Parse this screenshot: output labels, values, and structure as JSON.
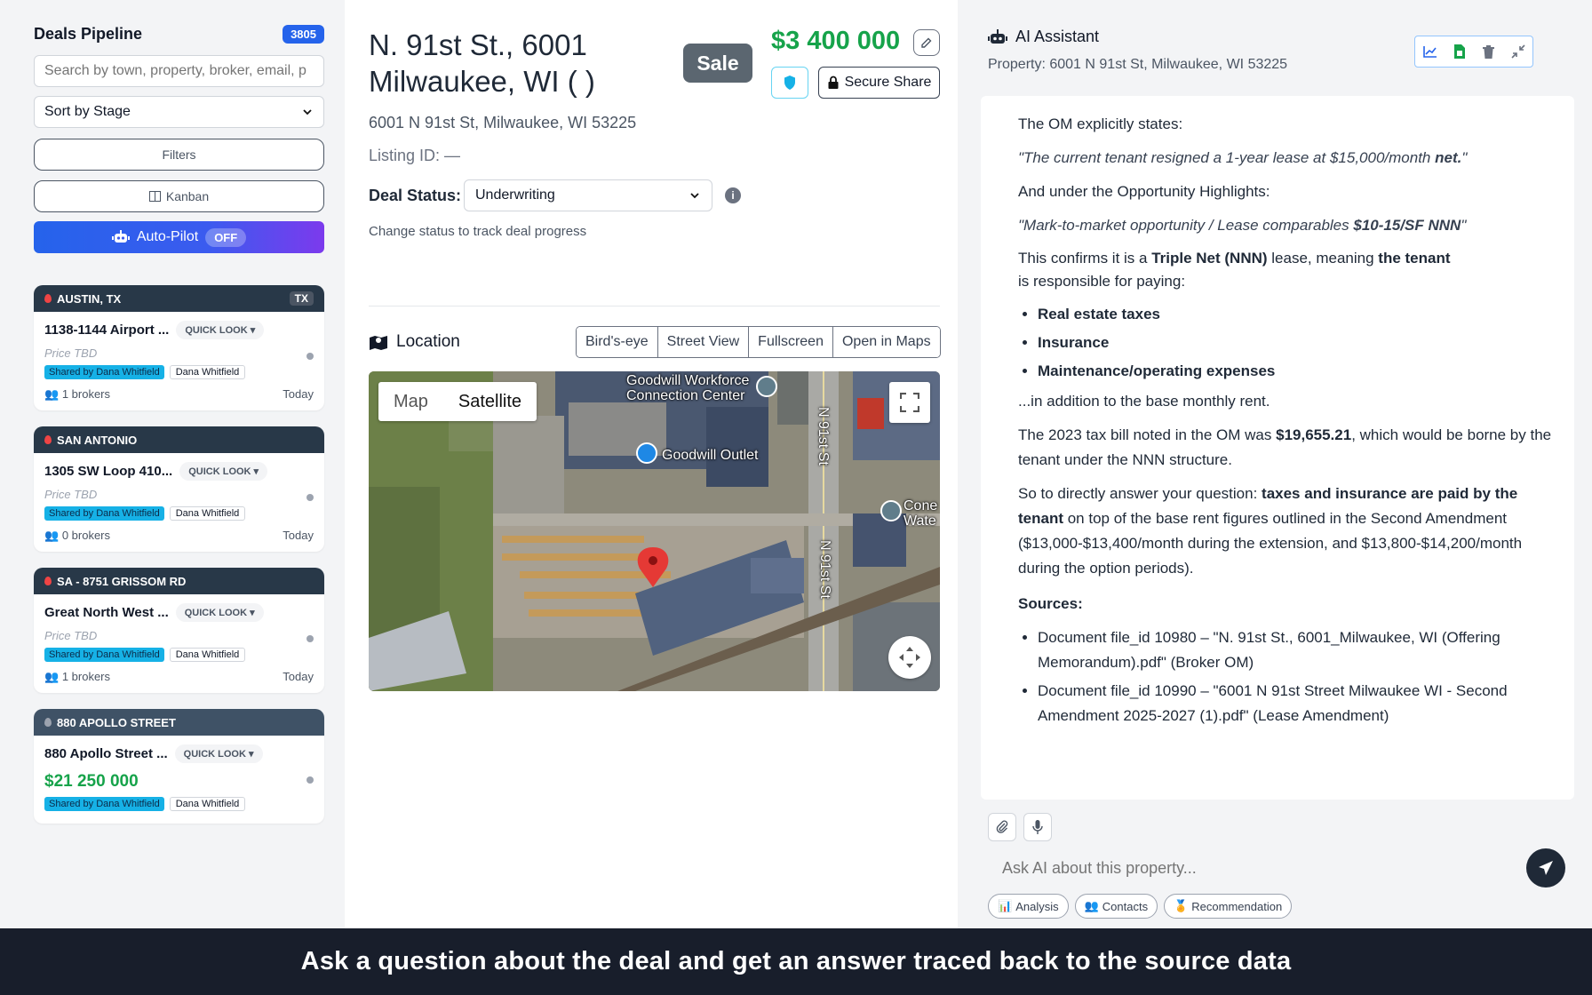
{
  "sidebar": {
    "title": "Deals Pipeline",
    "count": "3805",
    "search_placeholder": "Search by town, property, broker, email, p",
    "sort_label": "Sort by Stage",
    "filters_label": "Filters",
    "kanban_label": "Kanban",
    "autopilot_label": "Auto-Pilot",
    "autopilot_state": "OFF",
    "cards": [
      {
        "header": "AUSTIN, TX",
        "state_badge": "TX",
        "address": "1138-1144 Airport ...",
        "quick_look": "QUICK LOOK",
        "price": "Price TBD",
        "shared": "Shared by Dana Whitfield",
        "broker": "Dana Whitfield",
        "brokers": "1 brokers",
        "date": "Today"
      },
      {
        "header": "SAN ANTONIO",
        "address": "1305 SW Loop 410...",
        "quick_look": "QUICK LOOK",
        "price": "Price TBD",
        "shared": "Shared by Dana Whitfield",
        "broker": "Dana Whitfield",
        "brokers": "0 brokers",
        "date": "Today"
      },
      {
        "header": "SA - 8751 GRISSOM RD",
        "address": "Great North West ...",
        "quick_look": "QUICK LOOK",
        "price": "Price TBD",
        "shared": "Shared by Dana Whitfield",
        "broker": "Dana Whitfield",
        "brokers": "1 brokers",
        "date": "Today"
      },
      {
        "header": "880 APOLLO STREET",
        "address": "880 Apollo Street ...",
        "quick_look": "QUICK LOOK",
        "price": "$21 250 000",
        "shared": "Shared by Dana Whitfield",
        "broker": "Dana Whitfield"
      }
    ]
  },
  "main": {
    "title": "N. 91st St., 6001 Milwaukee, WI ( )",
    "sale_badge": "Sale",
    "price": "$3 400 000",
    "secure_share": "Secure Share",
    "address": "6001 N 91st St, Milwaukee, WI 53225",
    "listing_id": "Listing ID: —",
    "deal_status_label": "Deal Status:",
    "deal_status_value": "Underwriting",
    "deal_status_help": "Change status to track deal progress",
    "location_label": "Location",
    "map_tabs": [
      "Bird's-eye",
      "Street View",
      "Fullscreen",
      "Open in Maps"
    ],
    "map_type_map": "Map",
    "map_type_satellite": "Satellite",
    "map_labels": {
      "goodwill_center_1": "Goodwill Workforce",
      "goodwill_center_2": "Connection Center",
      "goodwill_outlet": "Goodwill Outlet",
      "street_n91": "N 91st St",
      "street_n91_b": "N 91st St",
      "cone_1": "Cone",
      "cone_2": "Wate"
    }
  },
  "ai": {
    "title": "AI Assistant",
    "property": "Property: 6001 N 91st St, Milwaukee, WI 53225",
    "msg": {
      "p1": "The OM explicitly states:",
      "q1a": "\"The current tenant resigned a 1-year lease at $15,000/month ",
      "q1b": "net.",
      "q1c": "\"",
      "p2": "And under the Opportunity Highlights:",
      "q2a": "\"Mark-to-market opportunity / Lease comparables ",
      "q2b": "$10-15/SF NNN",
      "q2c": "\"",
      "p3a": "This confirms it is a ",
      "p3b": "Triple Net (NNN)",
      "p3c": " lease, meaning ",
      "p3d": "the tenant",
      "p3e": "is responsible for paying:",
      "bullets": [
        "Real estate taxes",
        "Insurance",
        "Maintenance/operating expenses"
      ],
      "p4": "...in addition to the base monthly rent.",
      "p5a": "The 2023 tax bill noted in the OM was ",
      "p5b": "$19,655.21",
      "p5c": ", which would be borne by the tenant under the NNN structure.",
      "p6a": "So to directly answer your question: ",
      "p6b": "taxes and insurance are paid by the tenant",
      "p6c": " on top of the base rent figures outlined in the Second Amendment ($13,000-$13,400/month during the extension, and $13,800-$14,200/month during the option periods).",
      "sources_label": "Sources:",
      "sources": [
        "Document file_id 10980 – \"N. 91st St., 6001_Milwaukee, WI (Offering Memorandum).pdf\" (Broker OM)",
        "Document file_id 10990 – \"6001 N 91st Street Milwaukee WI - Second Amendment 2025-2027 (1).pdf\" (Lease Amendment)"
      ]
    },
    "input_placeholder": "Ask AI about this property...",
    "chips": [
      "Analysis",
      "Contacts",
      "Recommendation"
    ]
  },
  "caption": "Ask a question about the deal and get an answer traced back to the source data",
  "colors": {
    "accent": "#2563eb",
    "price_green": "#16a34a",
    "card_header": "#283848",
    "shared_tag": "#16b1e6"
  }
}
